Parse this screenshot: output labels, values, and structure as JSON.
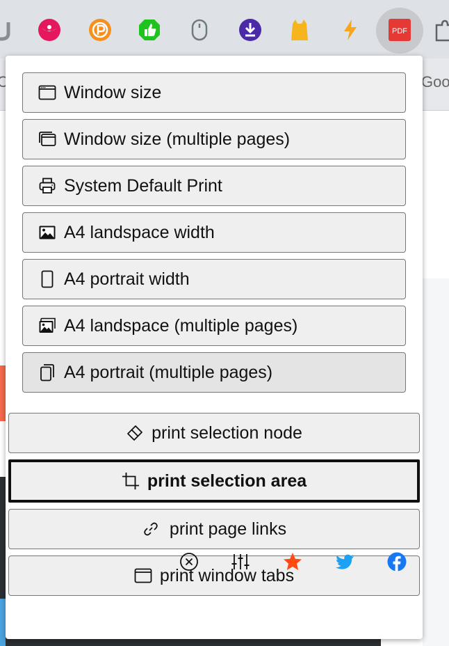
{
  "toolbar": {
    "extension_icons": [
      "u-extension-icon",
      "bird-extension-icon",
      "p-circle-extension-icon",
      "thumbs-up-extension-icon",
      "mouse-extension-icon",
      "download-extension-icon",
      "cat-extension-icon",
      "lightning-extension-icon",
      "pdf-extension-icon",
      "puzzle-extension-icon"
    ],
    "pdf_label": "PDF"
  },
  "background": {
    "left_fragment": "C",
    "right_fragment": "Goo"
  },
  "popup": {
    "size_options": [
      {
        "label": "Window size",
        "icon": "window-icon"
      },
      {
        "label": "Window size (multiple pages)",
        "icon": "windows-stack-icon"
      },
      {
        "label": "System Default Print",
        "icon": "printer-icon"
      },
      {
        "label": "A4 landspace width",
        "icon": "image-icon"
      },
      {
        "label": "A4 portrait width",
        "icon": "portrait-page-icon"
      },
      {
        "label": "A4 landspace (multiple pages)",
        "icon": "images-stack-icon"
      },
      {
        "label": "A4 portrait (multiple pages)",
        "icon": "pages-stack-icon"
      }
    ],
    "actions": {
      "selection_node": "print selection node",
      "selection_area": "print selection area",
      "page_links": "print page links",
      "window_tabs": "print window tabs"
    },
    "footer_icons": [
      "close-circle-icon",
      "sliders-icon",
      "star-icon",
      "twitter-icon",
      "facebook-icon"
    ]
  },
  "colors": {
    "star": "#ff4a12",
    "twitter": "#1da1f2",
    "facebook": "#1877f2",
    "pdf_red": "#e53935"
  }
}
